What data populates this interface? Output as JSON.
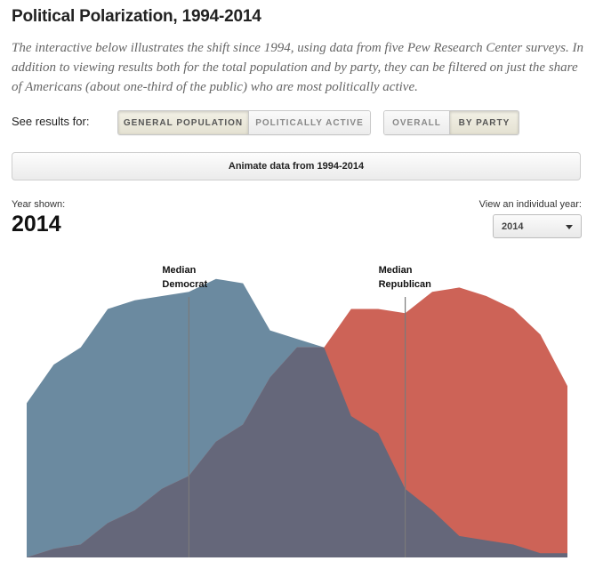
{
  "header": {
    "title": "Political Polarization, 1994-2014",
    "description": "The interactive below illustrates the shift since 1994, using data from five Pew Research Center surveys. In addition to viewing results both for the total population and by party, they can be filtered on just the share of Americans (about one-third of the public) who are most politically active."
  },
  "controls": {
    "see_results_label": "See results for:",
    "population_toggle": [
      {
        "label": "GENERAL POPULATION",
        "active": true
      },
      {
        "label": "POLITICALLY ACTIVE",
        "active": false
      }
    ],
    "view_toggle": [
      {
        "label": "OVERALL",
        "active": false
      },
      {
        "label": "BY PARTY",
        "active": true
      }
    ],
    "animate_label": "Animate data from 1994-2014",
    "year_shown_label": "Year shown:",
    "year_shown_value": "2014",
    "view_year_label": "View an individual year:",
    "selected_year": "2014"
  },
  "colors": {
    "democrat": "#6b8aa0",
    "republican": "#cd6357",
    "overlap": "#65677a",
    "median_line": "#7a7a7a"
  },
  "chart_data": {
    "type": "area",
    "x": [
      -10,
      -9,
      -8,
      -7,
      -6,
      -5,
      -4,
      -3,
      -2,
      -1,
      0,
      1,
      2,
      3,
      4,
      5,
      6,
      7,
      8,
      9,
      10
    ],
    "xlim": [
      -10,
      10
    ],
    "ylim": [
      0,
      7.2
    ],
    "grid": false,
    "series": [
      {
        "values": [
          3.6,
          4.5,
          4.9,
          5.8,
          6.0,
          6.1,
          6.2,
          6.5,
          6.4,
          5.3,
          5.1,
          4.9,
          3.3,
          2.9,
          1.6,
          1.1,
          0.5,
          0.4,
          0.3,
          0.1,
          0.1
        ]
      },
      {
        "values": [
          0.0,
          0.2,
          0.3,
          0.8,
          1.1,
          1.6,
          1.9,
          2.7,
          3.1,
          4.2,
          4.9,
          4.9,
          5.8,
          5.8,
          5.7,
          6.2,
          6.3,
          6.1,
          5.8,
          5.2,
          4.0
        ]
      }
    ],
    "annotations": [
      {
        "label_lines": [
          "Median",
          "Democrat"
        ],
        "x": -4.0
      },
      {
        "label_lines": [
          "Median",
          "Republican"
        ],
        "x": 4.0
      }
    ]
  }
}
